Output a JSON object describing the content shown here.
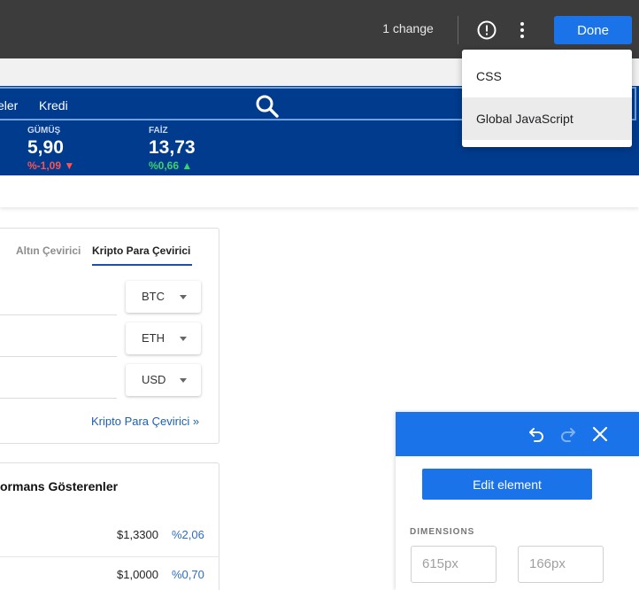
{
  "topbar": {
    "changes_text": "1 change",
    "done_label": "Done",
    "icons": [
      "alert-circle-icon",
      "more-vert-icon"
    ]
  },
  "menu": {
    "items": [
      "CSS",
      "Global JavaScript"
    ]
  },
  "site": {
    "nav_links": [
      "eler",
      "Kredi"
    ],
    "tickers": [
      {
        "label": "GÜMÜŞ",
        "value": "5,90",
        "change": "%-1,09",
        "direction": "down"
      },
      {
        "label": "FAİZ",
        "value": "13,73",
        "change": "%0,66",
        "direction": "up"
      }
    ],
    "converter": {
      "tabs": [
        "Altın Çevirici",
        "Kripto Para Çevirici"
      ],
      "active_tab": "Kripto Para Çevirici",
      "selects": [
        "BTC",
        "ETH",
        "USD"
      ],
      "link": "Kripto Para Çevirici »"
    },
    "performers": {
      "title": "ormans Gösterenler",
      "rows": [
        {
          "price": "$1,3300",
          "pct": "%2,06"
        },
        {
          "price": "$1,0000",
          "pct": "%0,70"
        }
      ]
    }
  },
  "panel": {
    "edit_label": "Edit element",
    "dimensions_label": "DIMENSIONS",
    "width_placeholder": "615px",
    "height_placeholder": "166px"
  },
  "colors": {
    "accent": "#1a73e8",
    "nav_blue": "#003b8e",
    "topbar": "#3c3c3c",
    "down": "#ff5252",
    "up": "#3ad46b",
    "link": "#1c5fb6"
  }
}
